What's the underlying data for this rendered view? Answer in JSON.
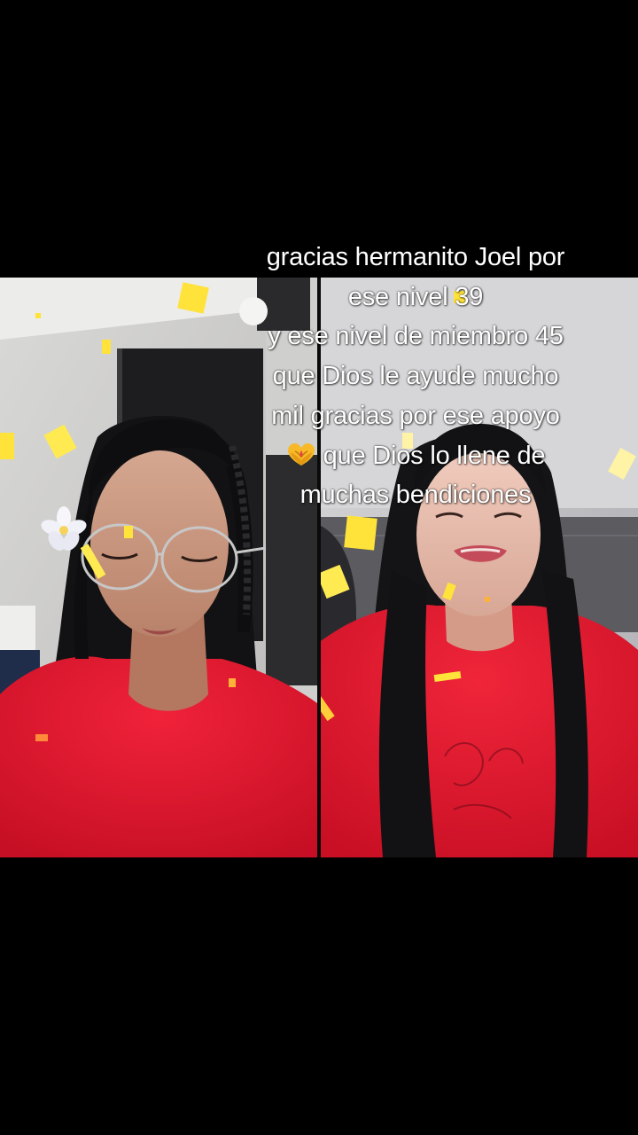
{
  "caption": {
    "lines": [
      "gracias hermanito Joel por",
      "ese nivel 39",
      "y ese nivel de miembro 45",
      "que Dios le ayude mucho",
      "mil gracias por ese apoyo",
      "que Dios lo llene de",
      "muchas bendiciones"
    ],
    "emoji": "heart-hands-emoji"
  },
  "colors": {
    "background": "#000000",
    "shirt": "#e3132b",
    "sparkle": "#ffe23a",
    "text": "#ffffff"
  }
}
